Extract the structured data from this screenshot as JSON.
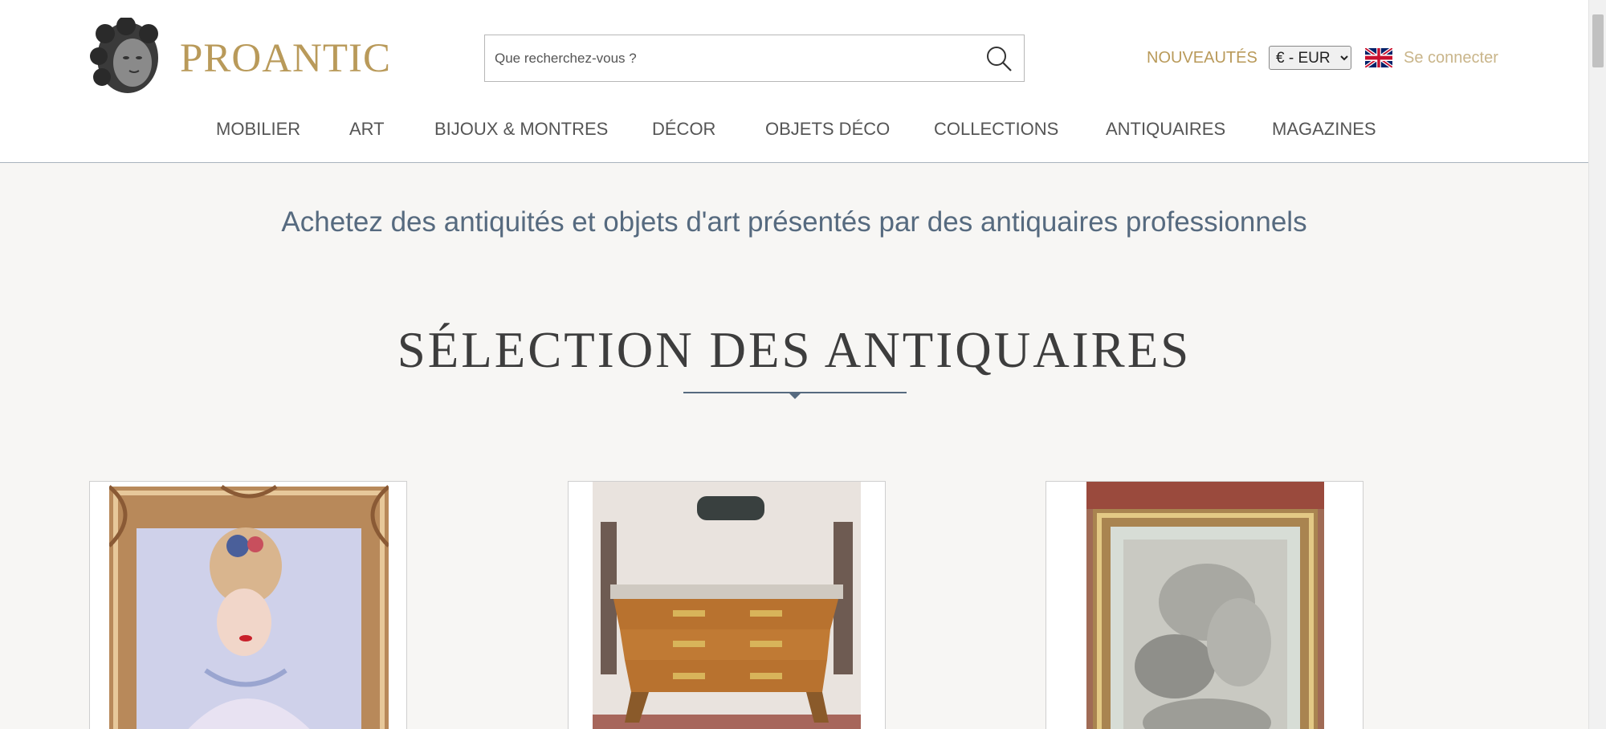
{
  "header": {
    "logo_text": "PROANTIC",
    "search_placeholder": "Que recherchez-vous ?",
    "nouveautes": "NOUVEAUTÉS",
    "currency": "€ - EUR",
    "login": "Se connecter"
  },
  "nav": {
    "items": [
      {
        "label": "MOBILIER"
      },
      {
        "label": "ART"
      },
      {
        "label": "BIJOUX & MONTRES"
      },
      {
        "label": "DÉCOR"
      },
      {
        "label": "OBJETS DÉCO"
      },
      {
        "label": "COLLECTIONS"
      },
      {
        "label": "ANTIQUAIRES"
      },
      {
        "label": "MAGAZINES"
      }
    ]
  },
  "main": {
    "tagline": "Achetez des antiquités et objets d'art présentés par des antiquaires professionnels",
    "section_title": "SÉLECTION DES ANTIQUAIRES"
  },
  "colors": {
    "gold": "#b99a5a",
    "slate": "#566a7f",
    "background": "#f7f6f4"
  },
  "icons": [
    "search-icon",
    "uk-flag-icon",
    "logo-head-icon"
  ]
}
